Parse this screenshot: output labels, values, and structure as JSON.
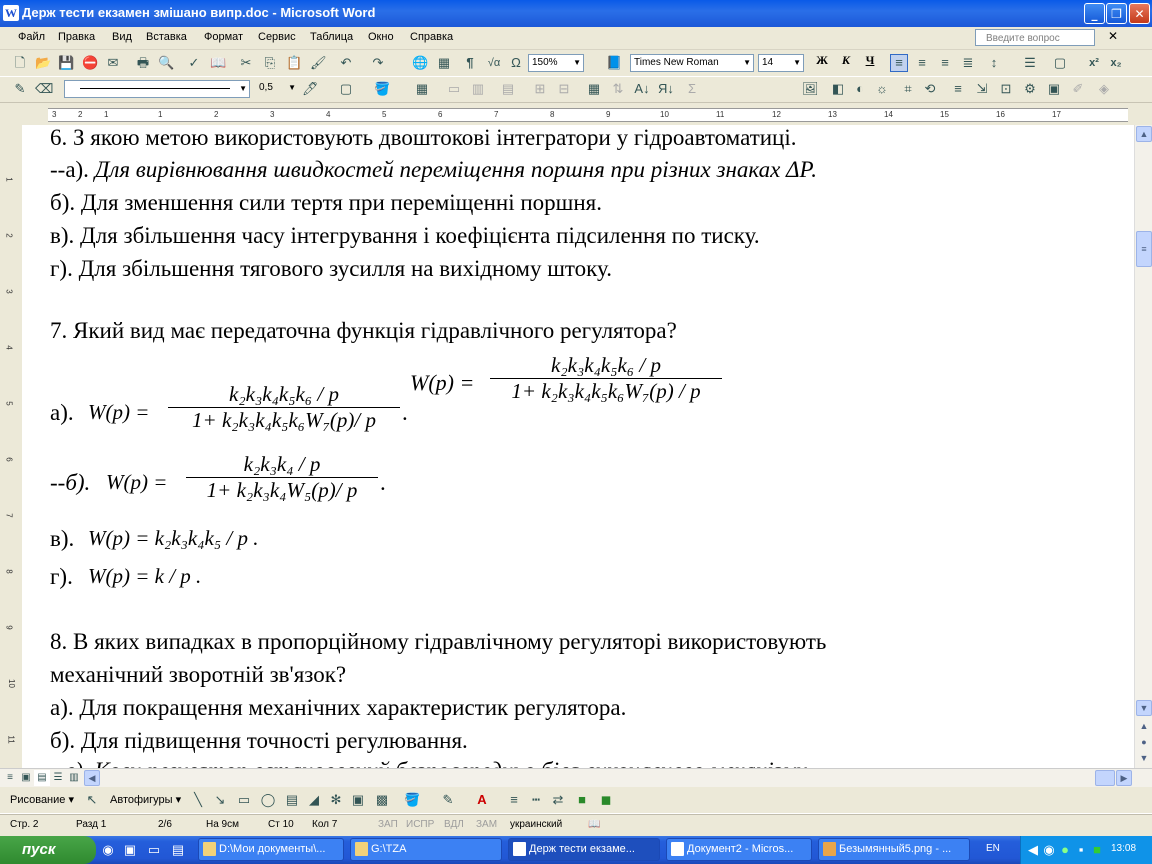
{
  "window": {
    "title": "Держ тести екзамен змішано випр.doc - Microsoft Word",
    "app_icon": "W",
    "controls": {
      "minimize": "_",
      "maximize": "❐",
      "close": "✕"
    }
  },
  "menu": {
    "items": [
      "Файл",
      "Правка",
      "Вид",
      "Вставка",
      "Формат",
      "Сервис",
      "Таблица",
      "Окно",
      "Справка"
    ],
    "help_placeholder": "Введите вопрос"
  },
  "toolbar": {
    "zoom": "150%",
    "font_name": "Times New Roman",
    "font_size": "14",
    "bold": "Ж",
    "italic": "К",
    "underline": "Ч",
    "line_width": "0,5",
    "paragraph_mark": "¶",
    "sigma": "Σ",
    "omega": "Ω"
  },
  "ruler": {
    "h_marks": [
      "3",
      "2",
      "1",
      "1",
      "2",
      "3",
      "4",
      "5",
      "6",
      "7",
      "8",
      "9",
      "10",
      "11",
      "12",
      "13",
      "14",
      "15",
      "16",
      "17"
    ],
    "v_marks": [
      "1",
      "2",
      "3",
      "4",
      "5",
      "6",
      "7",
      "8",
      "9",
      "10",
      "11"
    ]
  },
  "document": {
    "q6": {
      "question": "6. З якою метою використовують двоштокові інтегратори у гідроавтоматиці.",
      "a_prefix": "--а). ",
      "a_text": "Для вирівнювання швидкостей переміщення поршня при різних знаках ΔР.",
      "b": "б). Для зменшення сили тертя при переміщенні поршня.",
      "c": "в). Для збільшення часу інтегрування  і коефіцієнта підсилення по тиску.",
      "d": "г). Для збільшення тягового зусилля на вихідному штоку."
    },
    "q7": {
      "question": "7. Який вид має передаточна функція гідравлічного регулятора?",
      "float_lhs": "W(p) =",
      "float_num": "k₂k₃k₄k₅k₆ / p",
      "float_den": "1+ k₂k₃k₄k₅k₆W₇(p) / p",
      "a_label": "а).",
      "a_lhs": "W(p) =",
      "a_num": "k₂k₃k₄k₅k₆ / p",
      "a_den": "1+ k₂k₃k₄k₅k₆W₇(p)/ p",
      "b_label": "--б).",
      "b_lhs": "W(p) =",
      "b_num": "k₂k₃k₄ / p",
      "b_den": "1+ k₂k₃k₄W₅(p)/ p",
      "c_label": "в).",
      "c_formula": "W(p) = k₂k₃k₄k₅ / p .",
      "d_label": "г).",
      "d_formula": "W(p) = k / p ."
    },
    "q8": {
      "question_line1": "8.  В  яких  випадках  в  пропорційному  гідравлічному  регуляторі  використовують",
      "question_line2": "механічний зворотній зв'язок?",
      "a": "а). Для покращення механічних характеристик регулятора.",
      "b": "б). Для підвищення точності регулювання.",
      "c_partial": "--в). Коли регулятор встановлений безпосередньо біля виконавчого механізму."
    }
  },
  "drawbar": {
    "draw": "Рисование",
    "autoshapes": "Автофигуры",
    "font_color": "A"
  },
  "status": {
    "page": "Стр. 2",
    "section": "Разд 1",
    "pages": "2/6",
    "at": "На 9см",
    "line": "Ст 10",
    "col": "Кол 7",
    "rec": "ЗАП",
    "trk": "ИСПР",
    "ext": "ВДЛ",
    "ovr": "ЗАМ",
    "language": "украинский"
  },
  "taskbar": {
    "start": "пуск",
    "tasks": [
      "D:\\Мои документы\\...",
      "G:\\TZA",
      "Держ тести екзаме...",
      "Документ2 - Micros...",
      "Безымянный5.png - ..."
    ],
    "lang": "EN",
    "clock": "13:08"
  }
}
